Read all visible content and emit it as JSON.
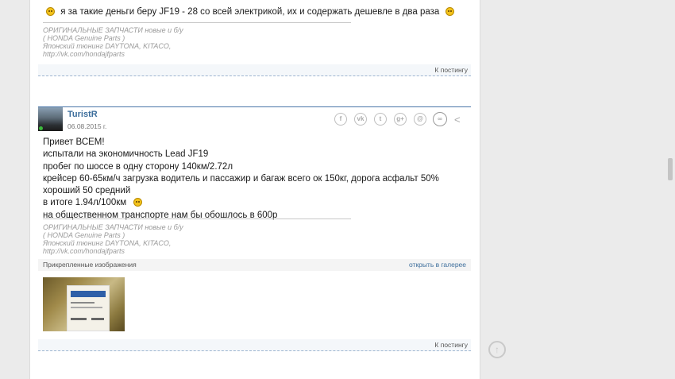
{
  "post1": {
    "text": "я за такие деньги беру JF19 - 28 со всей электрикой, их и содержать дешевле в два раза",
    "signature": [
      "ОРИГИНАЛЬНЫЕ ЗАПЧАСТИ новые и б/у",
      "( HONDA Genuine Parts )",
      "Японский тюнинг DAYTONA, KITACO,",
      "http://vk.com/hondajfparts"
    ],
    "footer_link": "К постингу"
  },
  "post2": {
    "author": "TuristR",
    "date": "06.08.2015 г.",
    "share_icons": [
      "facebook-icon",
      "vk-icon",
      "twitter-icon",
      "google-plus-icon",
      "mail-icon",
      "link-icon",
      "share-icon"
    ],
    "lines": [
      "Привет ВСЕМ!",
      "испытали на экономичность Lead JF19",
      "пробег по шоссе в одну сторону 140км/2.72л",
      "крейсер 60-65км/ч загрузка водитель и пассажир и багаж всего ок 150кг, дорога асфальт 50%",
      "хороший 50 средний",
      "в итоге 1.94л/100км",
      "на общественном транспорте нам бы обошлось в 600р"
    ],
    "signature": [
      "ОРИГИНАЛЬНЫЕ ЗАПЧАСТИ новые и б/у",
      "( HONDA Genuine Parts )",
      "Японский тюнинг DAYTONA, KITACO,",
      "http://vk.com/hondajfparts"
    ],
    "attachments_label": "Прикрепленные изображения",
    "gallery_link": "открыть в галерее",
    "footer_link": "К постингу"
  },
  "scroll_up_icon": "arrow-up-circle-icon"
}
